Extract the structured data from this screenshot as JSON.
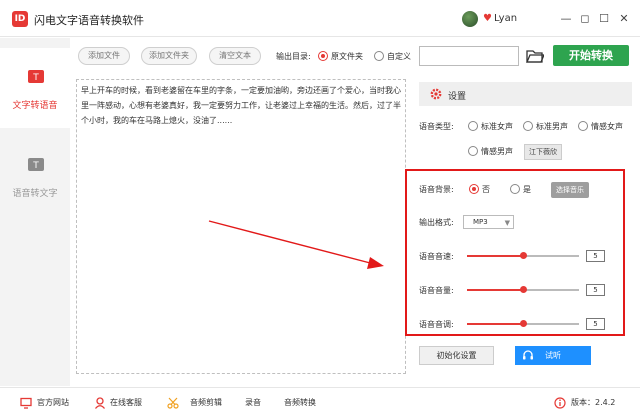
{
  "app": {
    "icon_text": "ID",
    "title": "闪电文字语音转换软件",
    "user_name": "Lyan"
  },
  "window": {
    "min": "—",
    "max": "☐",
    "restore": "◻",
    "close": "✕"
  },
  "sidebar": {
    "items": [
      {
        "label": "文字转语音",
        "active": true
      },
      {
        "label": "语音转文字",
        "active": false
      }
    ]
  },
  "toolbar": {
    "add_file": "添加文件",
    "add_folder": "添加文件夹",
    "clear_text": "清空文本",
    "output_dir_label": "输出目录:",
    "output_options": [
      "原文件夹",
      "自定义"
    ],
    "output_selected": "原文件夹",
    "path_value": "",
    "start_label": "开始转换"
  },
  "editor": {
    "text": "早上开车的时候，看到老婆留在车里的字条，一定要加油哟，旁边还画了个爱心，当时我心里一阵感动，心想有老婆真好，我一定要努力工作，让老婆过上幸福的生活。然后，过了半个小时，我的车在马路上熄火，没油了......"
  },
  "settings": {
    "title": "设置",
    "voice_type_label": "语音类型:",
    "voice_options": [
      "标准女声",
      "标准男声",
      "情感女声",
      "情感男声"
    ],
    "voice_selected": "",
    "voice_tag": "江下薇欣",
    "bg_label": "语音背景:",
    "bg_options": [
      "否",
      "是"
    ],
    "bg_selected": "否",
    "select_music": "选择音乐",
    "format_label": "输出格式:",
    "format_value": "MP3",
    "speed_label": "语音音速:",
    "speed_value": 5,
    "volume_label": "语音音量:",
    "volume_value": 5,
    "pitch_label": "语音音调:",
    "pitch_value": 5,
    "slider_max": 10,
    "reset_label": "初始化设置",
    "listen_label": "试听"
  },
  "footer": {
    "website": "官方网站",
    "service": "在线客服",
    "audio_edit": "音频剪辑",
    "record": "录音",
    "audio_convert": "音频转换",
    "version": "版本：2.4.2"
  },
  "colors": {
    "accent": "#e53935",
    "start_green": "#2ea44f",
    "listen_blue": "#1e90ff",
    "highlight_box": "#e21919",
    "arrow": "#e21919"
  }
}
